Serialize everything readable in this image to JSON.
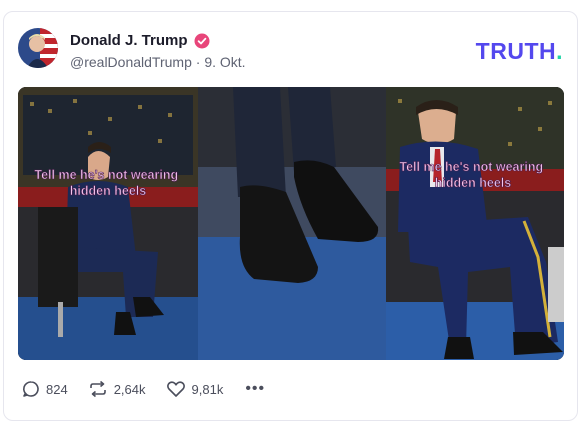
{
  "post": {
    "author_name": "Donald J. Trump",
    "handle": "@realDonaldTrump",
    "separator": "·",
    "date": "9. Okt."
  },
  "brand": {
    "logo_text": "TRUTH",
    "logo_dot": ".",
    "accent": "#5448ee",
    "dot_color": "#22d3a7",
    "verified_color": "#e8457a"
  },
  "media": {
    "caption_left": "Tell me he's not wearing hidden heels",
    "caption_right": "Tell me he's not wearing hidden heels"
  },
  "actions": {
    "replies": "824",
    "retruths": "2,64k",
    "likes": "9,81k",
    "more": "•••"
  },
  "icons": [
    "reply-icon",
    "retruth-icon",
    "like-icon",
    "more-icon",
    "verified-icon"
  ]
}
